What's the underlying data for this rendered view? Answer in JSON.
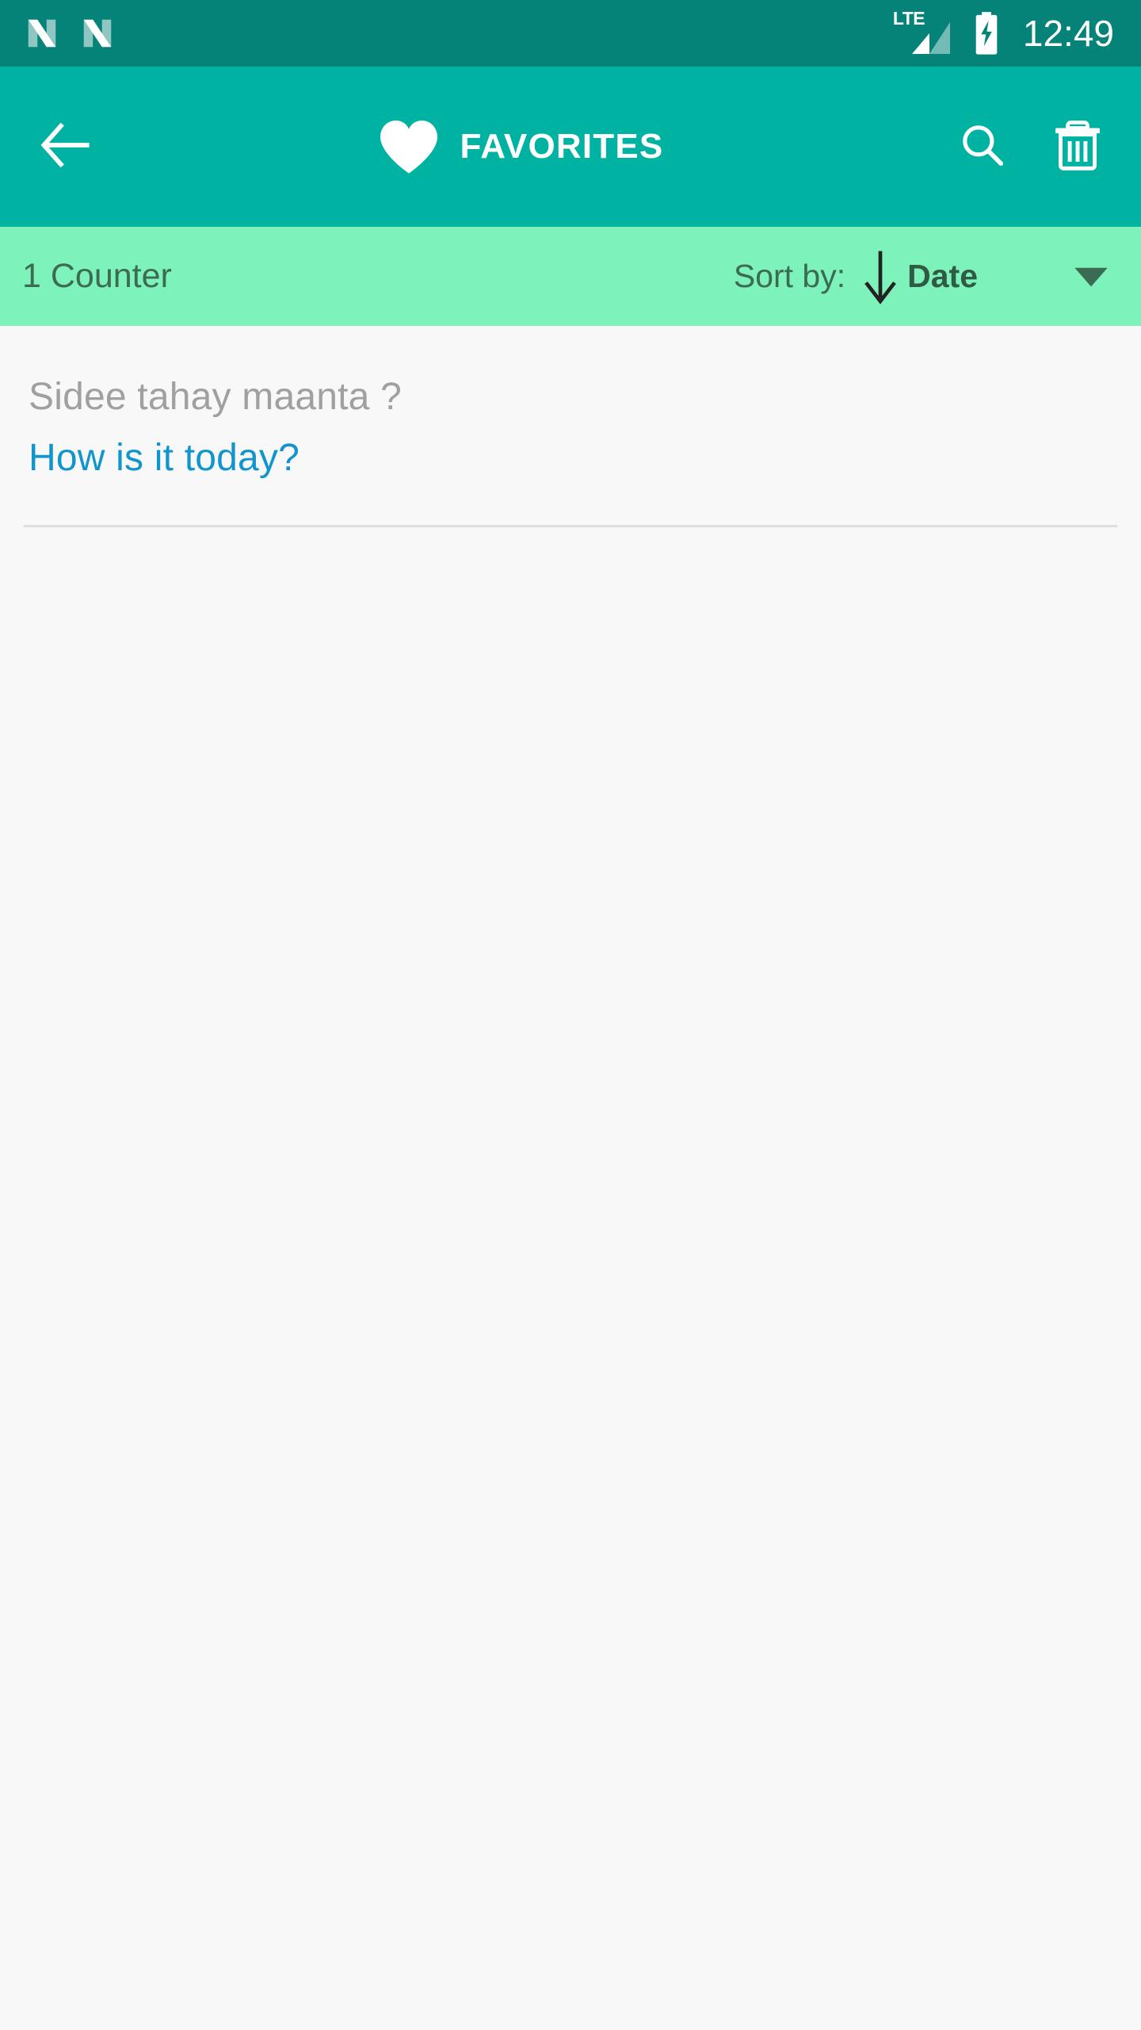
{
  "status_bar": {
    "notification_icons": [
      "n-app-icon",
      "n-app-icon"
    ],
    "network_label": "LTE",
    "signal_icon": "signal-bars-icon",
    "battery_icon": "battery-charging-icon",
    "time": "12:49"
  },
  "app_bar": {
    "back_icon": "back-arrow-icon",
    "heart_icon": "heart-icon",
    "title": "FAVORITES",
    "search_icon": "search-icon",
    "delete_icon": "trash-icon"
  },
  "sort_bar": {
    "counter": "1 Counter",
    "sort_label": "Sort by:",
    "sort_direction_icon": "arrow-down-icon",
    "sort_value": "Date",
    "dropdown_icon": "caret-down-icon"
  },
  "list": {
    "items": [
      {
        "source": "Sidee tahay maanta ?",
        "target": "How is it today?"
      }
    ]
  },
  "colors": {
    "status_bar": "#058378",
    "app_bar": "#00B2A2",
    "sort_bar": "#7DF2BB",
    "content_bg": "#F8F8F8",
    "source_text": "#A0A0A0",
    "target_text": "#1195CC",
    "sort_text": "#3C6B53",
    "divider": "#DEDEDE"
  }
}
